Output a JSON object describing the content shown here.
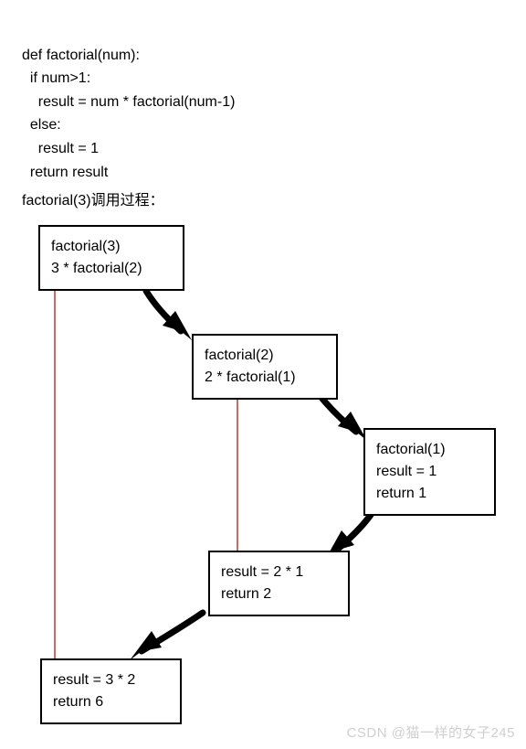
{
  "code": {
    "line1": "def factorial(num):",
    "line2": "  if num>1:",
    "line3": "    result = num * factorial(num-1)",
    "line4": "  else:",
    "line5": "    result = 1",
    "line6": "  return result"
  },
  "caption": "factorial(3)调用过程：",
  "boxes": {
    "call3": {
      "line1": "factorial(3)",
      "line2": "   3 * factorial(2)"
    },
    "call2": {
      "line1": "factorial(2)",
      "line2": "   2 * factorial(1)"
    },
    "call1": {
      "line1": "factorial(1)",
      "line2": "   result = 1",
      "line3": "   return 1"
    },
    "ret2": {
      "line1": "result = 2 * 1",
      "line2": "return 2"
    },
    "ret3": {
      "line1": "result = 3 * 2",
      "line2": "return 6"
    }
  },
  "watermark": "CSDN @猫一样的女子245"
}
